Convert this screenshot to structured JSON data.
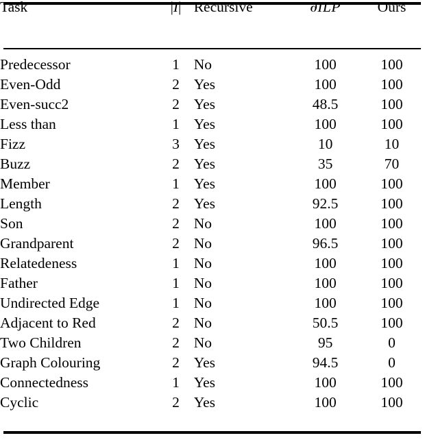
{
  "table": {
    "columns": [
      {
        "key": "task",
        "label": "Task",
        "align": "left"
      },
      {
        "key": "i",
        "label": "|I|",
        "align": "center"
      },
      {
        "key": "recursive",
        "label": "Recursive",
        "align": "left"
      },
      {
        "key": "dilp",
        "label": "∂ILP",
        "align": "center"
      },
      {
        "key": "ours",
        "label": "Ours",
        "align": "center"
      }
    ],
    "header": {
      "task": "Task",
      "i_bar_left": "|",
      "i_letter": "I",
      "i_bar_right": "|",
      "recursive": "Recursive",
      "dilp_partial": "∂",
      "dilp_letters": "ILP",
      "ours": "Ours"
    },
    "rows": [
      {
        "task": "Predecessor",
        "i": "1",
        "recursive": "No",
        "dilp": "100",
        "ours": "100"
      },
      {
        "task": "Even-Odd",
        "i": "2",
        "recursive": "Yes",
        "dilp": "100",
        "ours": "100"
      },
      {
        "task": "Even-succ2",
        "i": "2",
        "recursive": "Yes",
        "dilp": "48.5",
        "ours": "100"
      },
      {
        "task": "Less than",
        "i": "1",
        "recursive": "Yes",
        "dilp": "100",
        "ours": "100"
      },
      {
        "task": "Fizz",
        "i": "3",
        "recursive": "Yes",
        "dilp": "10",
        "ours": "10"
      },
      {
        "task": "Buzz",
        "i": "2",
        "recursive": "Yes",
        "dilp": "35",
        "ours": "70"
      },
      {
        "task": "Member",
        "i": "1",
        "recursive": "Yes",
        "dilp": "100",
        "ours": "100"
      },
      {
        "task": "Length",
        "i": "2",
        "recursive": "Yes",
        "dilp": "92.5",
        "ours": "100"
      },
      {
        "task": "Son",
        "i": "2",
        "recursive": "No",
        "dilp": "100",
        "ours": "100"
      },
      {
        "task": "Grandparent",
        "i": "2",
        "recursive": "No",
        "dilp": "96.5",
        "ours": "100"
      },
      {
        "task": "Relatedeness",
        "i": "1",
        "recursive": "No",
        "dilp": "100",
        "ours": "100"
      },
      {
        "task": "Father",
        "i": "1",
        "recursive": "No",
        "dilp": "100",
        "ours": "100"
      },
      {
        "task": "Undirected Edge",
        "i": "1",
        "recursive": "No",
        "dilp": "100",
        "ours": "100"
      },
      {
        "task": "Adjacent to Red",
        "i": "2",
        "recursive": "No",
        "dilp": "50.5",
        "ours": "100"
      },
      {
        "task": "Two Children",
        "i": "2",
        "recursive": "No",
        "dilp": "95",
        "ours": "0"
      },
      {
        "task": "Graph Colouring",
        "i": "2",
        "recursive": "Yes",
        "dilp": "94.5",
        "ours": "0"
      },
      {
        "task": "Connectedness",
        "i": "1",
        "recursive": "Yes",
        "dilp": "100",
        "ours": "100"
      },
      {
        "task": "Cyclic",
        "i": "2",
        "recursive": "Yes",
        "dilp": "100",
        "ours": "100"
      }
    ],
    "colors": {
      "text": "#000000",
      "background": "#ffffff",
      "rule": "#000000"
    }
  }
}
